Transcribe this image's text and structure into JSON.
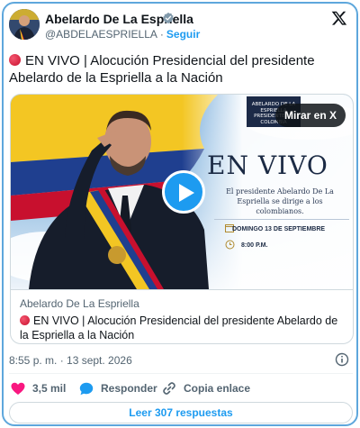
{
  "author": {
    "name": "Abelardo De La Espriella",
    "handle": "@ABDELAESPRIELLA",
    "separator": "·",
    "follow_label": "Seguir"
  },
  "tweet": {
    "text": "EN VIVO | Alocución Presidencial del presidente Abelardo de la Espriella a la Nación"
  },
  "media": {
    "watch_label": "Mirar en X",
    "seal_text": "ABELARDO DE LA ESPRIELLA PRESIDENTE DE COLOMBIA",
    "promo_title": "EN VIVO",
    "promo_description": "El presidente Abelardo De La Espriella se dirige a los colombianos.",
    "promo_date": "DOMINGO 13 DE SEPTIEMBRE",
    "promo_time": "8:00 P.M.",
    "caption_source": "Abelardo De La Espriella",
    "caption_title": "EN VIVO | Alocución Presidencial del presidente Abelardo de la Espriella a la Nación"
  },
  "timestamp": "8:55 p. m. · 13 sept. 2026",
  "actions": {
    "likes": "3,5 mil",
    "reply_label": "Responder",
    "copy_label": "Copia enlace"
  },
  "replies_button": "Leer 307 respuestas",
  "colors": {
    "accent": "#1d9bf0",
    "like": "#f91880",
    "border": "#5ea7dc"
  },
  "icons": [
    "verified-icon",
    "x-logo-icon",
    "red-circle-icon",
    "play-icon",
    "calendar-icon",
    "clock-icon",
    "info-icon",
    "heart-icon",
    "reply-icon",
    "link-icon"
  ]
}
